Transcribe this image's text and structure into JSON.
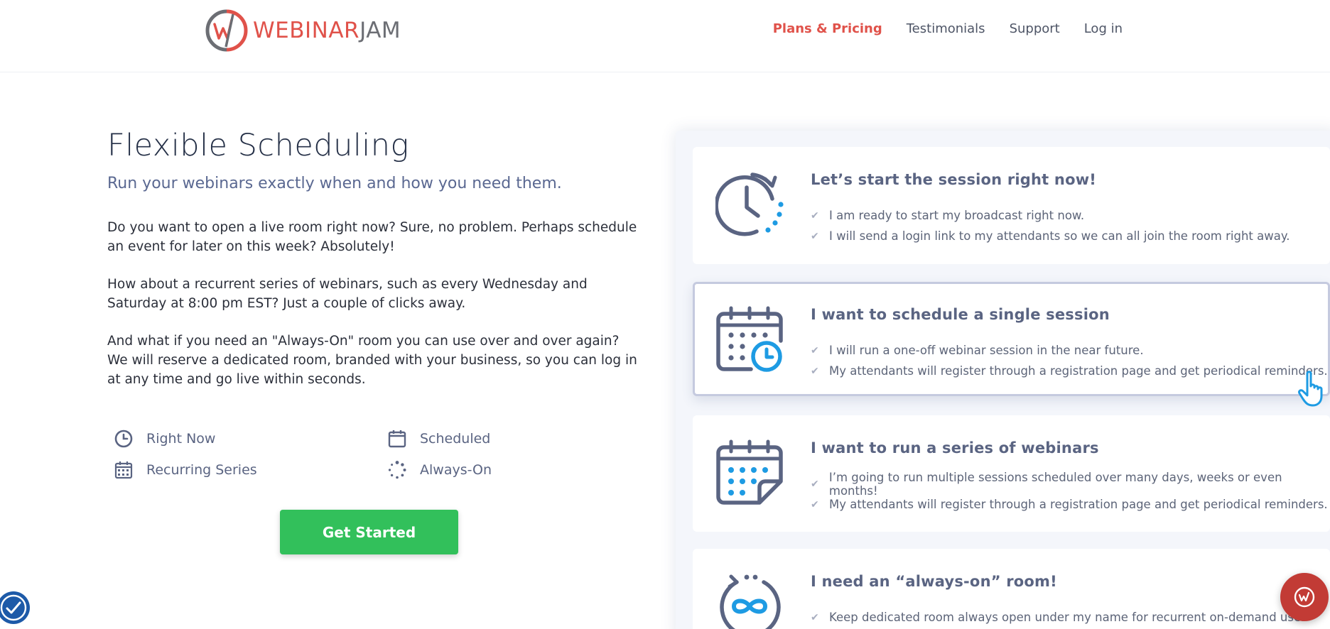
{
  "header": {
    "logo": {
      "part1": "WEBINAR",
      "part2": "JAM"
    },
    "nav": [
      {
        "label": "Plans & Pricing",
        "active": true
      },
      {
        "label": "Testimonials"
      },
      {
        "label": "Support"
      },
      {
        "label": "Log in"
      }
    ]
  },
  "main": {
    "title": "Flexible Scheduling",
    "subtitle": "Run your webinars exactly when and how you need them.",
    "paragraphs": [
      "Do you want to open a live room right now? Sure, no problem. Perhaps schedule an event for later on this week? Absolutely!",
      "How about a recurrent series of webinars, such as every Wednesday and Saturday at 8:00 pm EST? Just a couple of clicks away.",
      "And what if you need an \"Always-On\" room you can use over and over again? We will reserve a dedicated room, branded with your business,  so you can log in at any time and go live within seconds."
    ],
    "features": [
      {
        "label": "Right Now",
        "icon": "clock-icon"
      },
      {
        "label": "Scheduled",
        "icon": "calendar-icon"
      },
      {
        "label": "Recurring Series",
        "icon": "calendar-grid-icon"
      },
      {
        "label": "Always-On",
        "icon": "spinner-icon"
      }
    ],
    "cta_label": "Get Started"
  },
  "cards": [
    {
      "title": "Let’s start the session right now!",
      "icon": "clock-refresh-icon",
      "items": [
        "I am ready to start my broadcast right now.",
        "I will send a login link to my attendants so we can all join the room right away."
      ]
    },
    {
      "title": "I want to schedule a single session",
      "icon": "calendar-clock-icon",
      "items": [
        "I will run a one-off webinar session in the near future.",
        "My attendants will register through a registration page and get periodical reminders."
      ]
    },
    {
      "title": "I want to run a series of webinars",
      "icon": "calendar-series-icon",
      "items": [
        "I’m going to run multiple sessions scheduled over many days, weeks or even months!",
        "My attendants will register through a registration page and get periodical reminders."
      ]
    },
    {
      "title": "I need an “always-on” room!",
      "icon": "infinity-icon",
      "items": [
        "Keep dedicated room always open under my name for recurrent on-demand use."
      ]
    }
  ],
  "colors": {
    "brand_red": "#e0524a",
    "accent_blue": "#1e9be3",
    "slate": "#5a6482",
    "cta_green": "#32c05b"
  }
}
